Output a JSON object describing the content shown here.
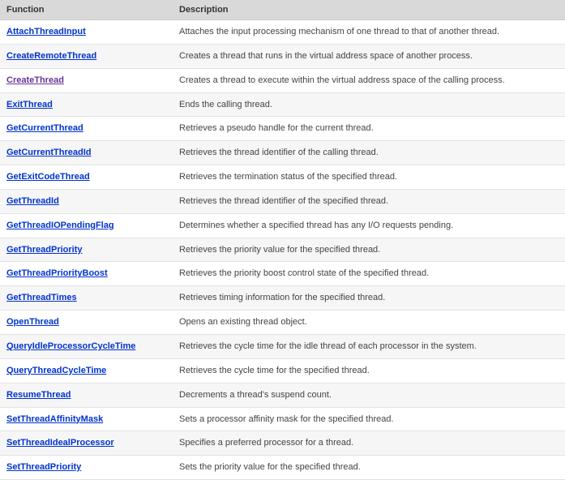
{
  "table": {
    "headers": {
      "function": "Function",
      "description": "Description"
    },
    "rows": [
      {
        "func": "AttachThreadInput",
        "desc": "Attaches the input processing mechanism of one thread to that of another thread.",
        "visited": false
      },
      {
        "func": "CreateRemoteThread",
        "desc": "Creates a thread that runs in the virtual address space of another process.",
        "visited": false
      },
      {
        "func": "CreateThread",
        "desc": "Creates a thread to execute within the virtual address space of the calling process.",
        "visited": true
      },
      {
        "func": "ExitThread",
        "desc": "Ends the calling thread.",
        "visited": false
      },
      {
        "func": "GetCurrentThread",
        "desc": "Retrieves a pseudo handle for the current thread.",
        "visited": false
      },
      {
        "func": "GetCurrentThreadId",
        "desc": "Retrieves the thread identifier of the calling thread.",
        "visited": false
      },
      {
        "func": "GetExitCodeThread",
        "desc": "Retrieves the termination status of the specified thread.",
        "visited": false
      },
      {
        "func": "GetThreadId",
        "desc": "Retrieves the thread identifier of the specified thread.",
        "visited": false
      },
      {
        "func": "GetThreadIOPendingFlag",
        "desc": "Determines whether a specified thread has any I/O requests pending.",
        "visited": false
      },
      {
        "func": "GetThreadPriority",
        "desc": "Retrieves the priority value for the specified thread.",
        "visited": false
      },
      {
        "func": "GetThreadPriorityBoost",
        "desc": "Retrieves the priority boost control state of the specified thread.",
        "visited": false
      },
      {
        "func": "GetThreadTimes",
        "desc": "Retrieves timing information for the specified thread.",
        "visited": false
      },
      {
        "func": "OpenThread",
        "desc": "Opens an existing thread object.",
        "visited": false
      },
      {
        "func": "QueryIdleProcessorCycleTime",
        "desc": "Retrieves the cycle time for the idle thread of each processor in the system.",
        "visited": false
      },
      {
        "func": "QueryThreadCycleTime",
        "desc": "Retrieves the cycle time for the specified thread.",
        "visited": false
      },
      {
        "func": "ResumeThread",
        "desc": "Decrements a thread's suspend count.",
        "visited": false
      },
      {
        "func": "SetThreadAffinityMask",
        "desc": "Sets a processor affinity mask for the specified thread.",
        "visited": false
      },
      {
        "func": "SetThreadIdealProcessor",
        "desc": "Specifies a preferred processor for a thread.",
        "visited": false
      },
      {
        "func": "SetThreadPriority",
        "desc": "Sets the priority value for the specified thread.",
        "visited": false
      }
    ]
  }
}
